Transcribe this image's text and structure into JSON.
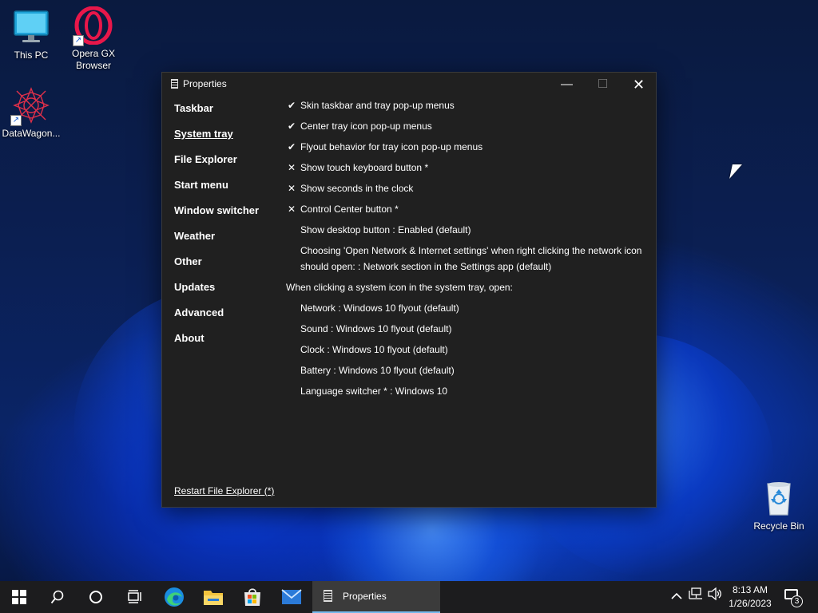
{
  "desktop": {
    "icons": [
      {
        "label": "This PC"
      },
      {
        "label": "Opera GX Browser"
      },
      {
        "label": "DataWagon..."
      },
      {
        "label": "Recycle Bin"
      }
    ]
  },
  "window": {
    "title": "Properties",
    "controls": {
      "minimize": "—",
      "maximize": "☐",
      "close": "✕"
    },
    "nav": [
      {
        "label": "Taskbar",
        "active": false
      },
      {
        "label": "System tray",
        "active": true
      },
      {
        "label": "File Explorer",
        "active": false
      },
      {
        "label": "Start menu",
        "active": false
      },
      {
        "label": "Window switcher",
        "active": false
      },
      {
        "label": "Weather",
        "active": false
      },
      {
        "label": "Other",
        "active": false
      },
      {
        "label": "Updates",
        "active": false
      },
      {
        "label": "Advanced",
        "active": false
      },
      {
        "label": "About",
        "active": false
      }
    ],
    "options": [
      {
        "mark": "✔",
        "text": "Skin taskbar and tray pop-up menus"
      },
      {
        "mark": "✔",
        "text": "Center tray icon pop-up menus"
      },
      {
        "mark": "✔",
        "text": "Flyout behavior for tray icon pop-up menus"
      },
      {
        "mark": "✕",
        "text": "Show touch keyboard button *"
      },
      {
        "mark": "✕",
        "text": "Show seconds in the clock"
      },
      {
        "mark": "✕",
        "text": "Control Center button *"
      },
      {
        "mark": "",
        "text": "Show desktop button : Enabled (default)"
      },
      {
        "mark": "",
        "text": "Choosing 'Open Network & Internet settings' when right clicking the network icon should open: : Network section in the Settings app (default)"
      }
    ],
    "section_heading": "When clicking a system icon in the system tray, open:",
    "sub_options": [
      {
        "text": "Network : Windows 10 flyout (default)"
      },
      {
        "text": "Sound : Windows 10 flyout (default)"
      },
      {
        "text": "Clock : Windows 10 flyout (default)"
      },
      {
        "text": "Battery : Windows 10 flyout (default)"
      },
      {
        "text": "Language switcher * : Windows 10"
      }
    ],
    "restart_link": "Restart File Explorer (*)"
  },
  "taskbar": {
    "active_task_label": "Properties",
    "clock_time": "8:13 AM",
    "clock_date": "1/26/2023",
    "notification_count": "3",
    "icons": [
      "start-icon",
      "search-icon",
      "cortana-icon",
      "task-view-icon",
      "edge-icon",
      "file-explorer-icon",
      "store-icon",
      "mail-icon",
      "properties-icon"
    ]
  }
}
